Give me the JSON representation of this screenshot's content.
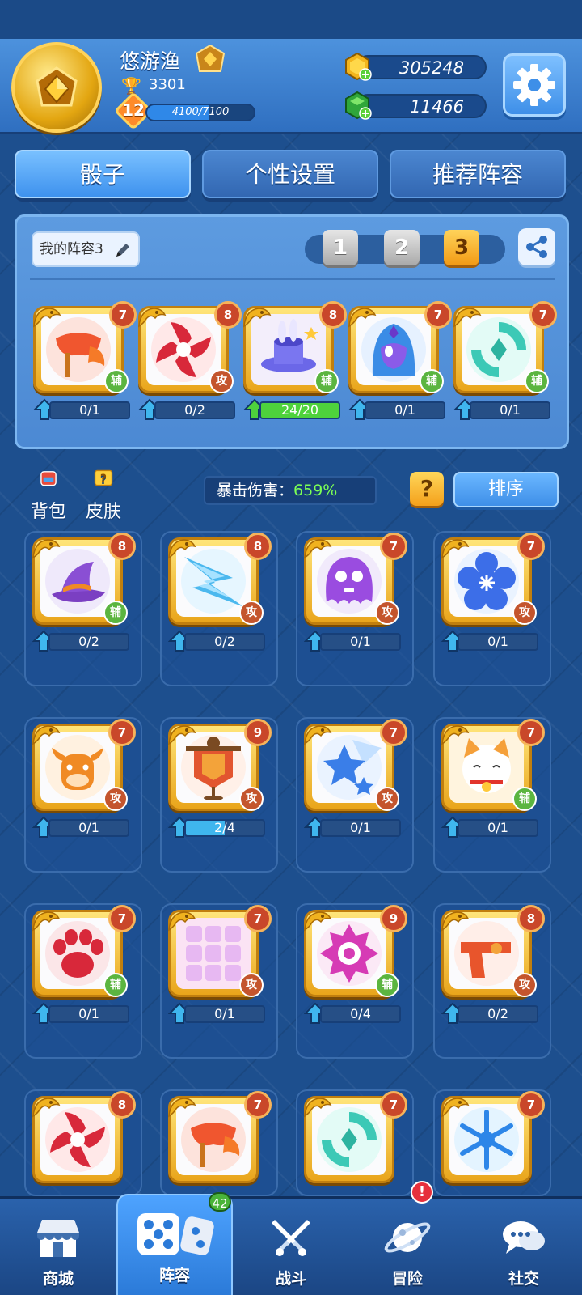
{
  "player": {
    "name": "悠游渔",
    "trophies": "3301",
    "level": "12",
    "xp_text": "4100/7100",
    "xp_fraction": 0.577
  },
  "currency": {
    "coins": "305248",
    "gems": "11466"
  },
  "tabs": [
    {
      "label": "骰子",
      "active": true
    },
    {
      "label": "个性设置",
      "active": false
    },
    {
      "label": "推荐阵容",
      "active": false
    }
  ],
  "deck": {
    "name": "我的阵容3",
    "selector": [
      "1",
      "2",
      "3"
    ],
    "selected": "3",
    "cards": [
      {
        "icon": "red-mask-icon",
        "level": "7",
        "role": "辅",
        "progress": "0/1",
        "fraction": 0
      },
      {
        "icon": "shuriken-icon",
        "level": "8",
        "role": "攻",
        "progress": "0/2",
        "fraction": 0
      },
      {
        "icon": "magic-hat-icon",
        "level": "8",
        "role": "辅",
        "progress": "24/20",
        "fraction": 1
      },
      {
        "icon": "hooded-figure-icon",
        "level": "7",
        "role": "辅",
        "progress": "0/1",
        "fraction": 0
      },
      {
        "icon": "teal-vortex-icon",
        "level": "7",
        "role": "辅",
        "progress": "0/1",
        "fraction": 0
      }
    ]
  },
  "side_buttons": {
    "backpack": "背包",
    "skin": "皮肤"
  },
  "crit": {
    "label": "暴击伤害：",
    "value": "659%"
  },
  "help_label": "?",
  "sort_label": "排序",
  "collection": [
    {
      "icon": "witch-hat-icon",
      "level": "8",
      "role": "辅",
      "progress": "0/2",
      "fraction": 0
    },
    {
      "icon": "lightning-icon",
      "level": "8",
      "role": "攻",
      "progress": "0/2",
      "fraction": 0
    },
    {
      "icon": "ghost-icon",
      "level": "7",
      "role": "攻",
      "progress": "0/1",
      "fraction": 0
    },
    {
      "icon": "flower-icon",
      "level": "7",
      "role": "攻",
      "progress": "0/1",
      "fraction": 0
    },
    {
      "icon": "bull-icon",
      "level": "7",
      "role": "攻",
      "progress": "0/1",
      "fraction": 0
    },
    {
      "icon": "banner-icon",
      "level": "9",
      "role": "攻",
      "progress": "2/4",
      "fraction": 0.5
    },
    {
      "icon": "star-icon",
      "level": "7",
      "role": "攻",
      "progress": "0/1",
      "fraction": 0
    },
    {
      "icon": "lucky-cat-icon",
      "level": "7",
      "role": "辅",
      "progress": "0/1",
      "fraction": 0
    },
    {
      "icon": "paw-icon",
      "level": "7",
      "role": "辅",
      "progress": "0/1",
      "fraction": 0
    },
    {
      "icon": "grid-icon",
      "level": "7",
      "role": "攻",
      "progress": "0/1",
      "fraction": 0
    },
    {
      "icon": "eye-monster-icon",
      "level": "9",
      "role": "辅",
      "progress": "0/4",
      "fraction": 0
    },
    {
      "icon": "gun-icon",
      "level": "8",
      "role": "攻",
      "progress": "0/2",
      "fraction": 0
    },
    {
      "icon": "shuriken-icon",
      "level": "8",
      "role": "",
      "progress": "",
      "fraction": 0
    },
    {
      "icon": "red-mask-icon",
      "level": "7",
      "role": "",
      "progress": "",
      "fraction": 0
    },
    {
      "icon": "teal-vortex-icon",
      "level": "7",
      "role": "",
      "progress": "",
      "fraction": 0
    },
    {
      "icon": "snowflake-icon",
      "level": "7",
      "role": "",
      "progress": "",
      "fraction": 0
    }
  ],
  "nav": [
    {
      "label": "商城",
      "icon": "shop-icon"
    },
    {
      "label": "阵容",
      "icon": "dice-icon",
      "badge": "42",
      "active": true
    },
    {
      "label": "战斗",
      "icon": "crossed-swords-icon"
    },
    {
      "label": "冒险",
      "icon": "planet-icon",
      "alert": "!"
    },
    {
      "label": "社交",
      "icon": "chat-icon"
    }
  ]
}
